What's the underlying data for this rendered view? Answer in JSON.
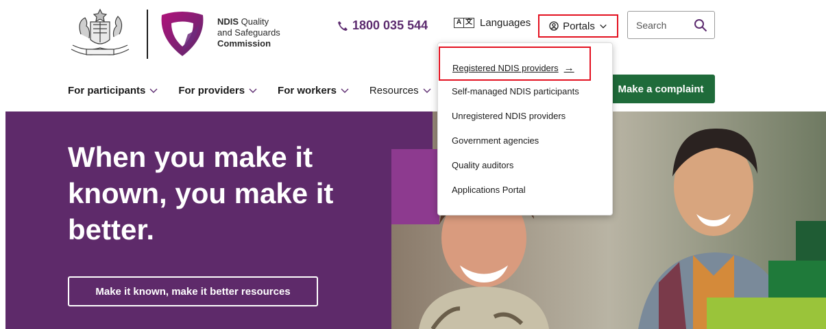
{
  "header": {
    "brand": {
      "line1_bold": "NDIS",
      "line1_rest": " Quality",
      "line2": "and Safeguards",
      "line3": "Commission"
    },
    "phone": "1800 035 544",
    "languages_label": "Languages",
    "lang_icon_letters": [
      "A",
      "文"
    ],
    "portals_label": "Portals",
    "search_placeholder": "Search"
  },
  "nav": {
    "items": [
      {
        "label": "For participants",
        "bold": true
      },
      {
        "label": "For providers",
        "bold": true
      },
      {
        "label": "For workers",
        "bold": true
      },
      {
        "label": "Resources",
        "bold": false
      }
    ],
    "complaint_label": "Make a complaint"
  },
  "portals_menu": {
    "items": [
      "Registered NDIS providers",
      "Self-managed NDIS participants",
      "Unregistered NDIS providers",
      "Government agencies",
      "Quality auditors",
      "Applications Portal"
    ],
    "first_arrow": "→"
  },
  "hero": {
    "title": "When you make it known, you make it better.",
    "button_label": "Make it known, make it better resources"
  },
  "colors": {
    "purple": "#5e2a6a",
    "brand_purple": "#5b2a6e",
    "green": "#1f6b3a",
    "highlight_red": "#e3101f"
  }
}
